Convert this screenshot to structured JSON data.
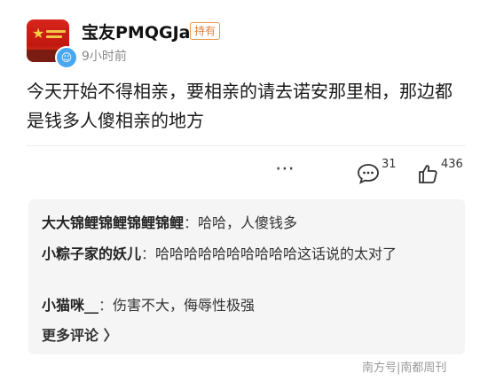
{
  "post": {
    "username": "宝友PMQGJa",
    "tag": "持有",
    "time": "9小时前",
    "content": "今天开始不得相亲，要相亲的请去诺安那里相，那边都是钱多人傻相亲的地方",
    "more_icon": "ellipsis-icon",
    "comment_count": "31",
    "like_count": "436"
  },
  "replies": [
    {
      "author": "大大锦鲤锦鲤锦鲤锦鲤",
      "sep": "：",
      "text": "哈哈，人傻钱多"
    },
    {
      "author": "小粽子家的妖儿",
      "sep": "：",
      "text": "哈哈哈哈哈哈哈哈哈哈这话说的太对了"
    },
    {
      "author": "小猫咪__",
      "sep": "：",
      "text": "伤害不大，侮辱性极强"
    }
  ],
  "more_comments": "更多评论 〉",
  "watermark": "南方号|南都周刊",
  "colors": {
    "tag": "#e0813a",
    "reply_bg": "#f5f5f5",
    "badge": "#4aa8f0"
  }
}
